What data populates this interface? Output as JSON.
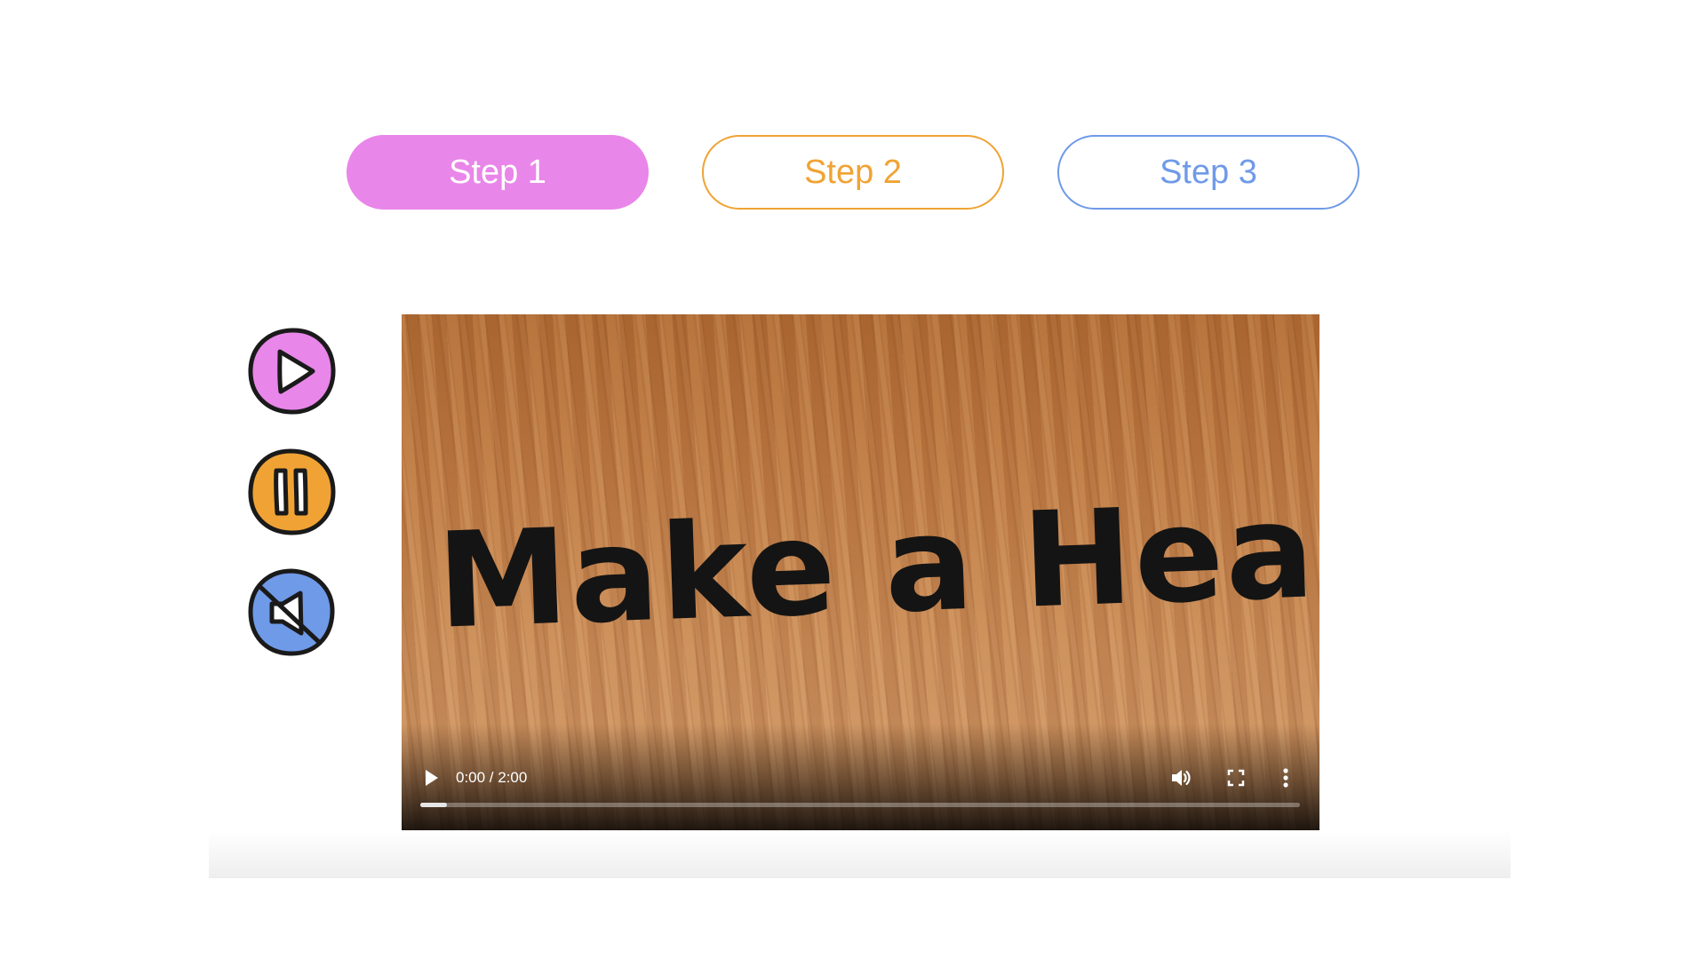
{
  "steps": [
    {
      "label": "Step 1",
      "active": true,
      "color": "#e986e9"
    },
    {
      "label": "Step 2",
      "active": false,
      "color": "#f0a334"
    },
    {
      "label": "Step 3",
      "active": false,
      "color": "#6f9ae8"
    }
  ],
  "controls": [
    {
      "icon": "play-icon",
      "color": "#e986e9"
    },
    {
      "icon": "pause-icon",
      "color": "#f0a334"
    },
    {
      "icon": "mute-icon",
      "color": "#6f9ae8"
    }
  ],
  "video": {
    "title": "Make a Heart",
    "time": "0:00 / 2:00",
    "progress": 0.03,
    "player_icons": [
      "play-icon",
      "volume-icon",
      "fullscreen-icon",
      "more-options-icon"
    ]
  }
}
